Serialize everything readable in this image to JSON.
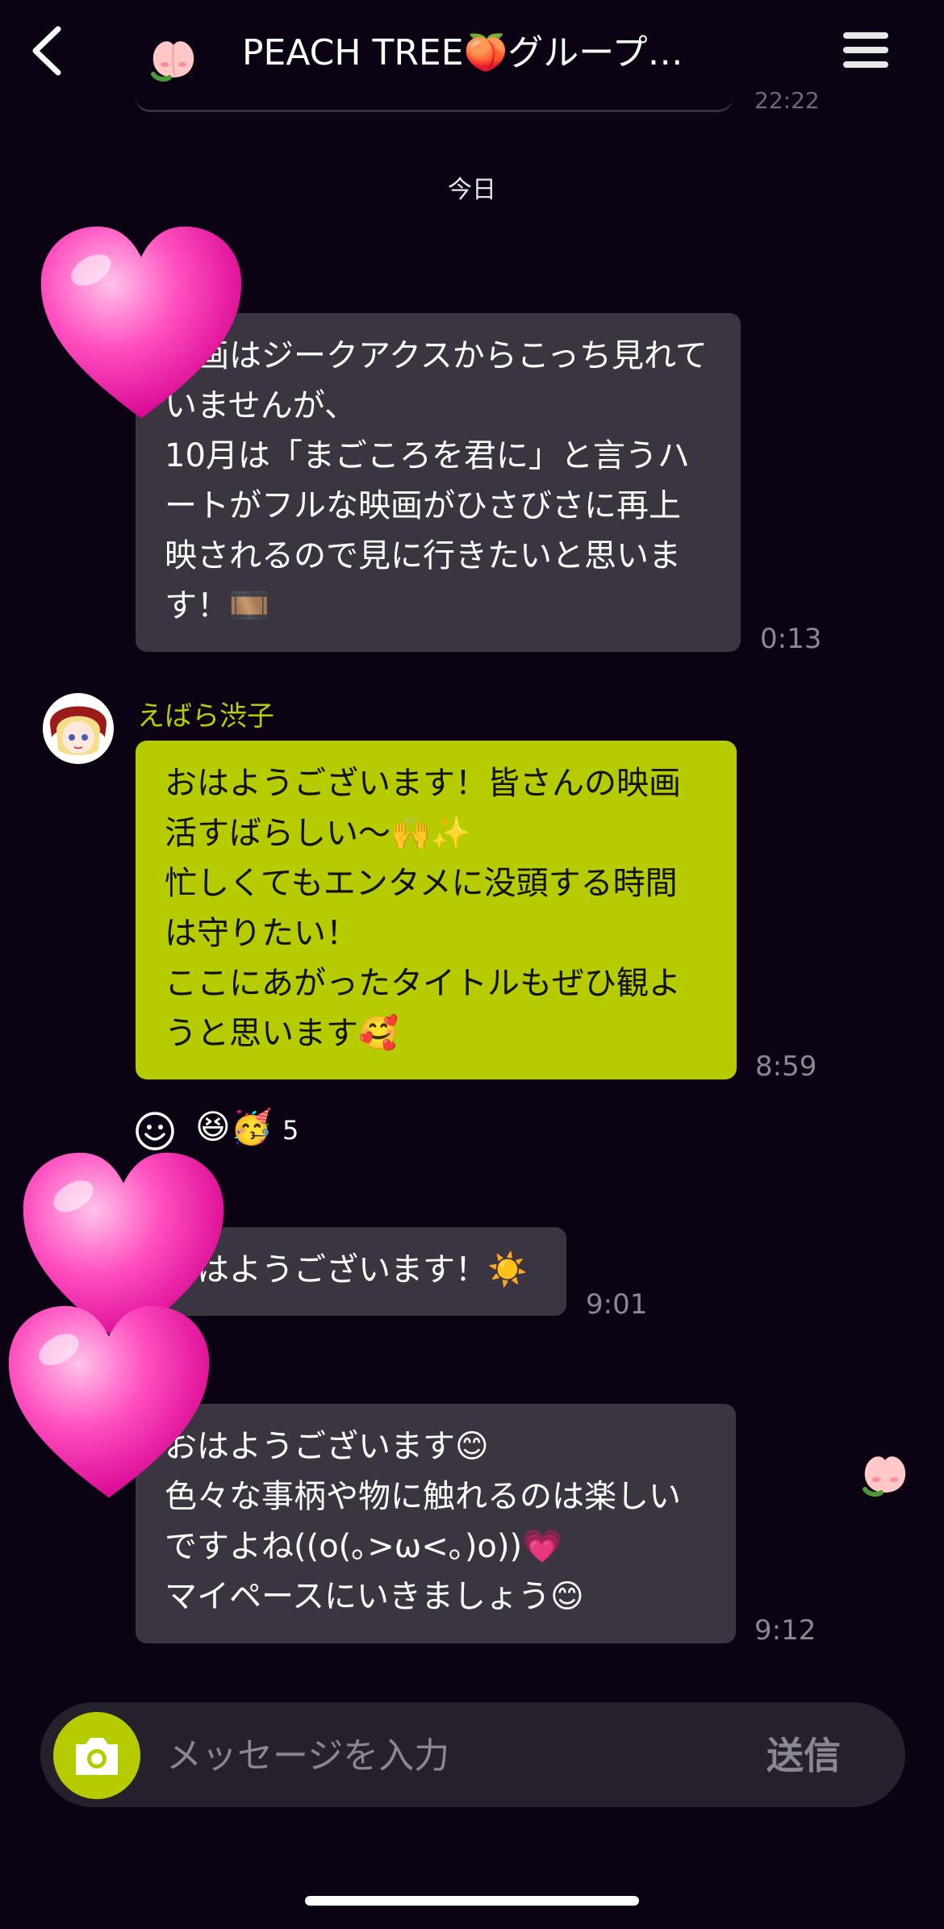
{
  "header": {
    "title": "PEACH TREE🍑グループチ…",
    "back_icon": "chevron-left-icon",
    "menu_icon": "hamburger-menu-icon",
    "group_avatar": "peach-avatar"
  },
  "previous_message": {
    "time": "22:22"
  },
  "date_separator": "今日",
  "messages": [
    {
      "text": "映画はジークアクスからこっち見れていませんが、\n10月は「まごころを君に」と言うハートがフルな映画がひさびさに再上映されるので見に行きたいと思います！🎞️",
      "time": "0:13"
    },
    {
      "sender": "えばら渋子",
      "text": "おはようございます！皆さんの映画活すばらしい〜🙌✨\n忙しくてもエンタメに没頭する時間は守りたい！\nここにあがったタイトルもぜひ観ようと思います🥰",
      "time": "8:59",
      "reactions": {
        "emojis": "😆🥳",
        "count": "5"
      }
    },
    {
      "text": "おはようございます！☀️",
      "time": "9:01"
    },
    {
      "text": "おはようございます😊\n色々な事柄や物に触れるのは楽しいですよね((o(｡>ω<｡)o))💗\nマイペースにいきましょう😊",
      "time": "9:12"
    }
  ],
  "input": {
    "placeholder": "メッセージを入力",
    "send_label": "送信"
  },
  "colors": {
    "background": "#0b0214",
    "accent": "#b6cb00",
    "bubble": "#3a3541",
    "heart": "#ff3ab5"
  }
}
